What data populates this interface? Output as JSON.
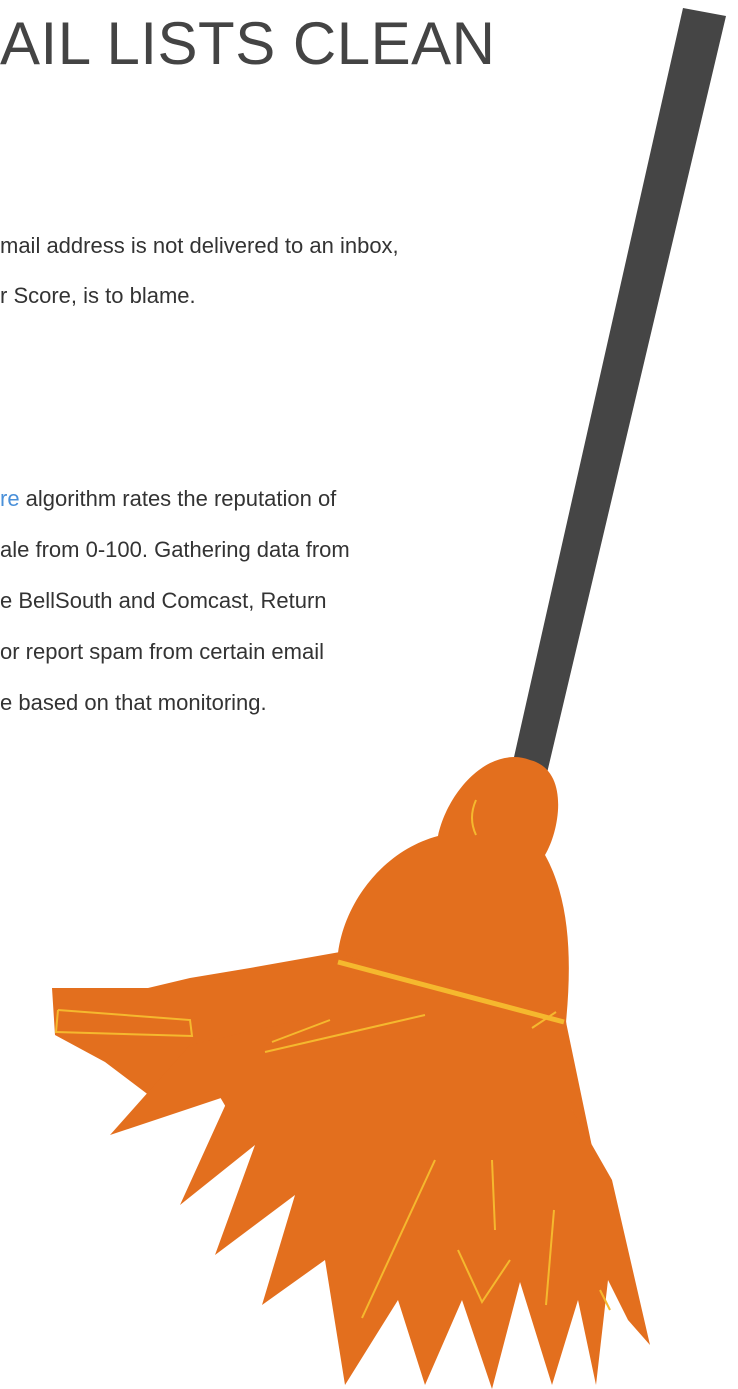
{
  "heading": "AIL LISTS CLEAN",
  "para1": {
    "line1": "mail address is not delivered to an inbox,",
    "line2": "r Score, is to blame."
  },
  "para2": {
    "line1_link": "re",
    "line1_rest": " algorithm rates the reputation of",
    "line2": "ale from 0-100. Gathering data from",
    "line3": "e BellSouth and Comcast, Return",
    "line4": " or report spam from certain email",
    "line5": "e based on that monitoring."
  },
  "illustration": {
    "icon": "broom-icon",
    "handle_color": "#454545",
    "head_color": "#e36f1e",
    "straw_color": "#f5b82e"
  }
}
